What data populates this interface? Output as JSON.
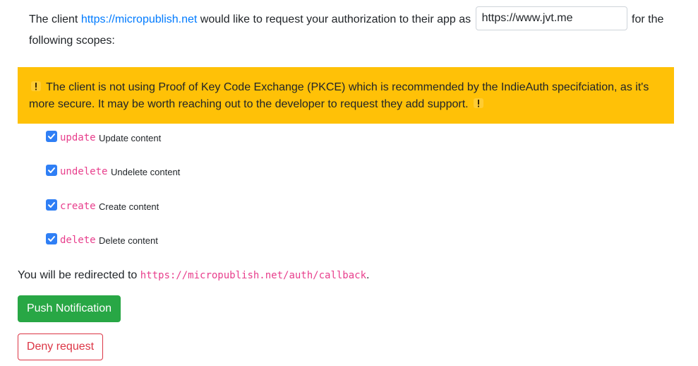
{
  "intro": {
    "text_before": "The client ",
    "client_url": "https://micropublish.net",
    "text_middle": " would like to request your authorization to their app as ",
    "me_value": "https://www.jvt.me",
    "text_after": " for the following scopes:"
  },
  "alert": {
    "message": "The client is not using Proof of Key Code Exchange (PKCE) which is recommended by the IndieAuth specifciation, as it's more secure. It may be worth reaching out to the developer to request they add support.",
    "icon": "warning-icon",
    "color": "#ffc107"
  },
  "scopes": [
    {
      "name": "update",
      "description": "Update content",
      "checked": true
    },
    {
      "name": "undelete",
      "description": "Undelete content",
      "checked": true
    },
    {
      "name": "create",
      "description": "Create content",
      "checked": true
    },
    {
      "name": "delete",
      "description": "Delete content",
      "checked": true
    }
  ],
  "redirect": {
    "text": "You will be redirected to ",
    "url": "https://micropublish.net/auth/callback",
    "suffix": "."
  },
  "buttons": {
    "push": "Push Notification",
    "deny": "Deny request"
  },
  "colors": {
    "link": "#007bff",
    "code": "#e83e8c",
    "success": "#28a745",
    "danger": "#dc3545",
    "checkbox": "#2f7ff5"
  }
}
